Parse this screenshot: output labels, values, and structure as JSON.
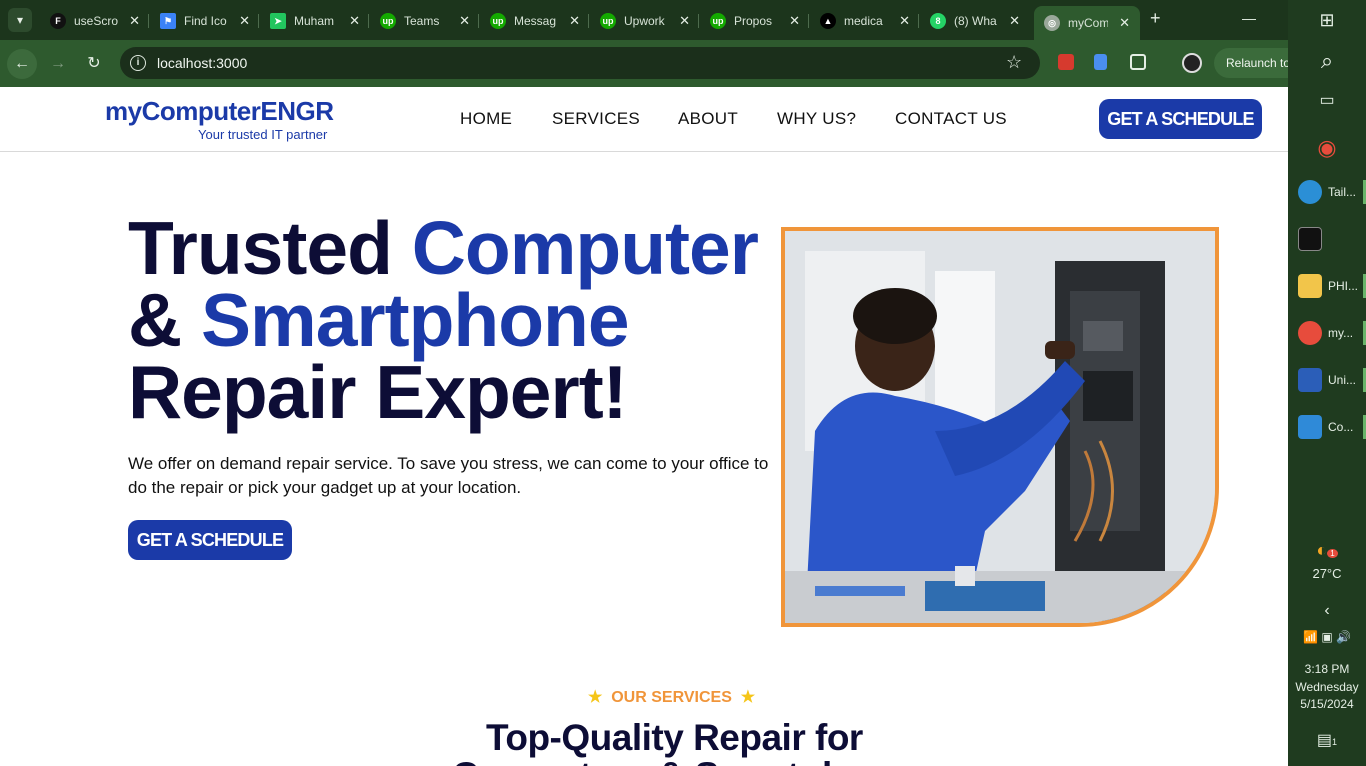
{
  "browser": {
    "tabs": [
      {
        "title": "useScro",
        "icon": "framer-icon",
        "color": "#111111"
      },
      {
        "title": "Find Ico",
        "icon": "flag-icon",
        "color": "#3b82f6"
      },
      {
        "title": "Muham",
        "icon": "send-icon",
        "color": "#22c55e"
      },
      {
        "title": "Teams",
        "icon": "upwork-icon",
        "color": "#14a800"
      },
      {
        "title": "Messag",
        "icon": "upwork-icon",
        "color": "#14a800"
      },
      {
        "title": "Upwork",
        "icon": "upwork-icon",
        "color": "#14a800"
      },
      {
        "title": "Propos",
        "icon": "upwork-icon",
        "color": "#14a800"
      },
      {
        "title": "medica",
        "icon": "vercel-icon",
        "color": "#000000"
      },
      {
        "title": "(8) Wha",
        "icon": "whatsapp-icon",
        "color": "#25d366"
      },
      {
        "title": "myCom",
        "icon": "globe-icon",
        "color": "#9aa89a"
      }
    ],
    "url": "localhost:3000",
    "relaunch_label": "Relaunch to"
  },
  "site": {
    "logo": "myComputerENGR",
    "tagline": "Your trusted IT partner",
    "nav": [
      "HOME",
      "SERVICES",
      "ABOUT",
      "WHY US?",
      "CONTACT US"
    ],
    "cta": "GET A SCHEDULE",
    "hero": {
      "line1_a": "Trusted ",
      "line1_b": "Computer",
      "line2_a": "& ",
      "line2_b": "Smartphone",
      "line3": "Repair Expert!",
      "description": "We offer on demand repair service. To save you stress, we can come to your office to do the repair or pick your gadget up at your location.",
      "cta": "GET A SCHEDULE"
    },
    "services": {
      "label": "OUR SERVICES",
      "title": "Top-Quality Repair for",
      "title2": "Computers & Smartphones"
    },
    "colors": {
      "primary": "#1b3aa8",
      "accent": "#f0953a",
      "heading": "#0d0d36"
    }
  },
  "taskbar": {
    "apps": [
      {
        "label": "Tail...",
        "icon": "edge-profile-icon"
      },
      {
        "label": "",
        "icon": "terminal-icon"
      },
      {
        "label": "PHI...",
        "icon": "folder-icon"
      },
      {
        "label": "my...",
        "icon": "chrome-icon"
      },
      {
        "label": "Uni...",
        "icon": "word-icon"
      },
      {
        "label": "Co...",
        "icon": "vscode-icon"
      }
    ],
    "weather": "27°C",
    "weather_badge": "1",
    "time": "3:18 PM",
    "day": "Wednesday",
    "date": "5/15/2024",
    "notification_count": "1"
  }
}
